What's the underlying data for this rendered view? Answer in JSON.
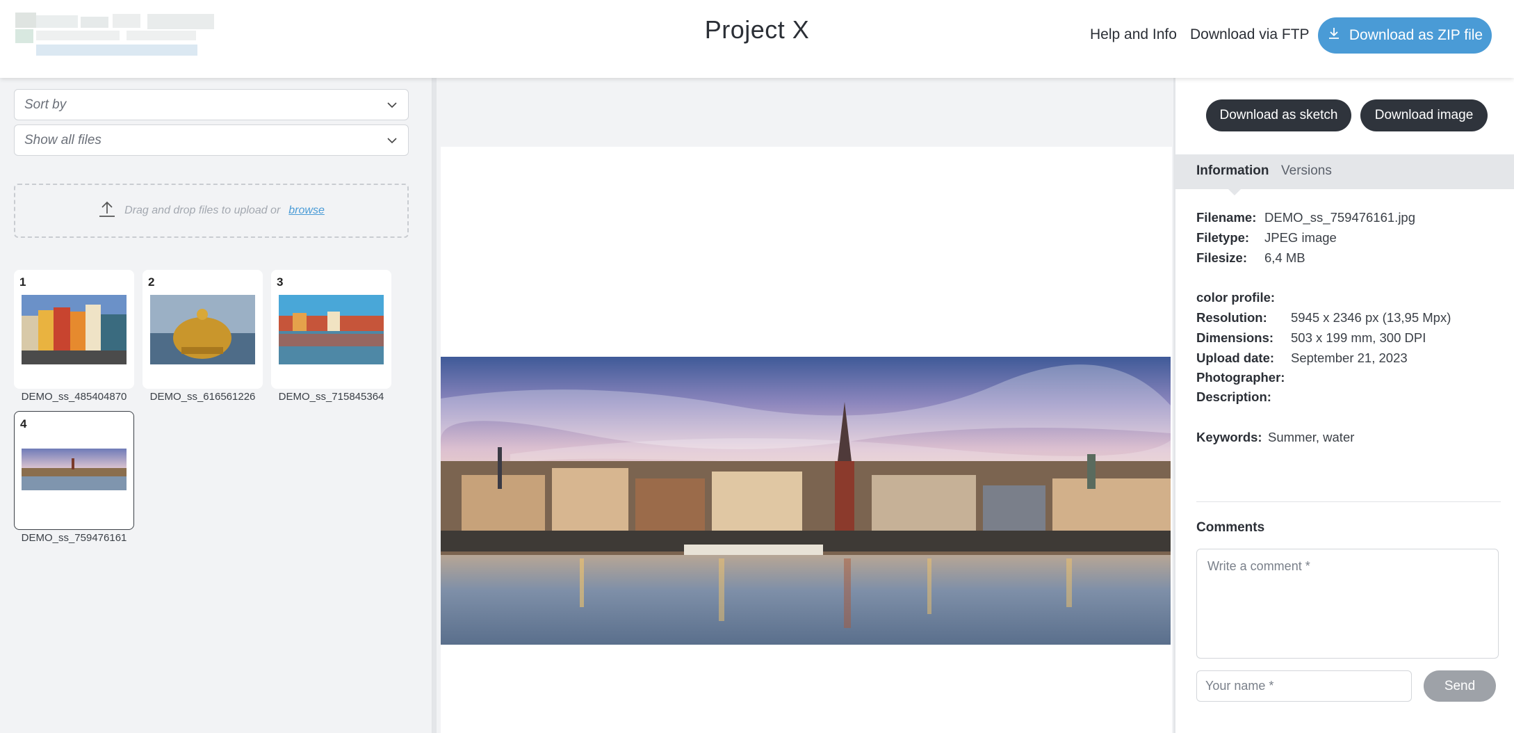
{
  "header": {
    "title": "Project X",
    "nav": {
      "help": "Help and Info",
      "ftp": "Download via FTP"
    },
    "zip_button": "Download as ZIP file",
    "accent": "#4a9bd6"
  },
  "left": {
    "sort_by": "Sort by",
    "filter": "Show all files",
    "upload": {
      "text": "Drag and drop files to upload or",
      "link": "browse"
    },
    "files": [
      {
        "num": "1",
        "name": "DEMO_ss_485404870"
      },
      {
        "num": "2",
        "name": "DEMO_ss_616561226"
      },
      {
        "num": "3",
        "name": "DEMO_ss_715845364"
      },
      {
        "num": "4",
        "name": "DEMO_ss_759476161",
        "selected": true
      }
    ]
  },
  "right": {
    "buttons": {
      "sketch": "Download as sketch",
      "image": "Download image"
    },
    "tabs": {
      "info": "Information",
      "versions": "Versions"
    },
    "info": {
      "filename_k": "Filename:",
      "filename_v": "DEMO_ss_759476161.jpg",
      "filetype_k": "Filetype:",
      "filetype_v": "JPEG image",
      "filesize_k": "Filesize:",
      "filesize_v": "6,4 MB",
      "color_k": "color profile:",
      "resolution_k": "Resolution:",
      "resolution_v": "5945 x 2346 px (13,95 Mpx)",
      "dimensions_k": "Dimensions:",
      "dimensions_v": "503 x 199 mm, 300 DPI",
      "upload_k": "Upload date:",
      "upload_v": "September 21, 2023",
      "photographer_k": "Photographer:",
      "description_k": "Description:",
      "keywords_k": "Keywords:",
      "keywords_v": "Summer, water"
    },
    "comments": {
      "title": "Comments",
      "placeholder": "Write a comment *",
      "name_placeholder": "Your name *",
      "send": "Send"
    }
  }
}
